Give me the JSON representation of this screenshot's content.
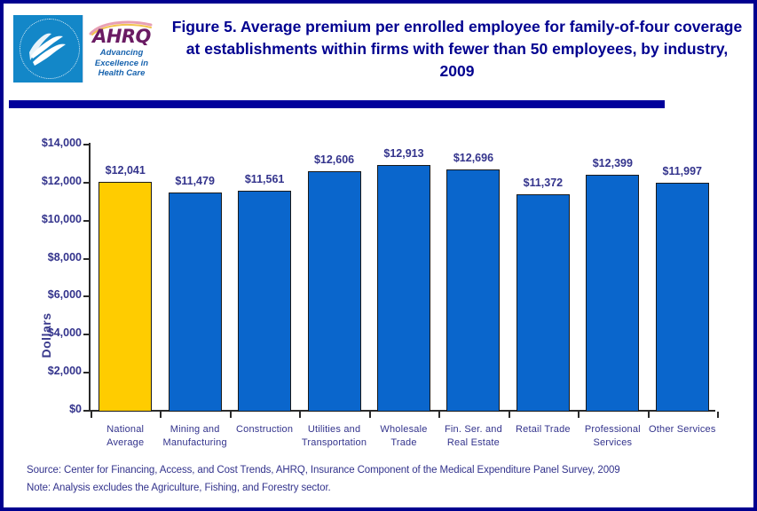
{
  "header": {
    "title": "Figure 5. Average premium per enrolled employee for family-of-four coverage at establishments within firms with fewer than 50 employees, by industry, 2009",
    "logo": {
      "agency_wordmark": "AHRQ",
      "tagline_line1": "Advancing",
      "tagline_line2": "Excellence in",
      "tagline_line3": "Health Care",
      "seal_name": "hhs-seal"
    }
  },
  "colors": {
    "frame": "#00008F",
    "title_text": "#00008F",
    "rule": "#00009B",
    "highlight_bar": "#FFCC00",
    "bar": "#0A66CC",
    "label_text": "#33338C"
  },
  "footer": {
    "source": "Source: Center for Financing, Access, and Cost Trends, AHRQ, Insurance Component of the Medical Expenditure Panel Survey, 2009",
    "note": "Note: Analysis excludes the Agriculture, Fishing, and Forestry sector."
  },
  "chart_data": {
    "type": "bar",
    "title": "Figure 5. Average premium per enrolled employee for family-of-four coverage at establishments within firms with fewer than 50 employees, by industry, 2009",
    "xlabel": "",
    "ylabel": "Dollars",
    "ylim": [
      0,
      14000
    ],
    "ytick_step": 2000,
    "ytick_labels": [
      "$14,000",
      "$12,000",
      "$10,000",
      "$8,000",
      "$6,000",
      "$4,000",
      "$2,000",
      "$0"
    ],
    "ytick_values": [
      14000,
      12000,
      10000,
      8000,
      6000,
      4000,
      2000,
      0
    ],
    "grid": false,
    "legend": false,
    "categories": [
      "National Average",
      "Mining and Manufacturing",
      "Construction",
      "Utilities and Transportation",
      "Wholesale Trade",
      "Fin. Ser. and Real Estate",
      "Retail Trade",
      "Professional Services",
      "Other Services"
    ],
    "category_lines": [
      [
        "National",
        "Average"
      ],
      [
        "Mining and",
        "Manufacturing"
      ],
      [
        "Construction",
        ""
      ],
      [
        "Utilities and",
        "Transportation"
      ],
      [
        "Wholesale",
        "Trade"
      ],
      [
        "Fin. Ser. and",
        "Real Estate"
      ],
      [
        "Retail Trade",
        ""
      ],
      [
        "Professional",
        "Services"
      ],
      [
        "Other Services",
        ""
      ]
    ],
    "values": [
      12041,
      11479,
      11561,
      12606,
      12913,
      12696,
      11372,
      12399,
      11997
    ],
    "value_labels": [
      "$12,041",
      "$11,479",
      "$11,561",
      "$12,606",
      "$12,913",
      "$12,696",
      "$11,372",
      "$12,399",
      "$11,997"
    ],
    "bar_colors": [
      "#FFCC00",
      "#0A66CC",
      "#0A66CC",
      "#0A66CC",
      "#0A66CC",
      "#0A66CC",
      "#0A66CC",
      "#0A66CC",
      "#0A66CC"
    ]
  }
}
